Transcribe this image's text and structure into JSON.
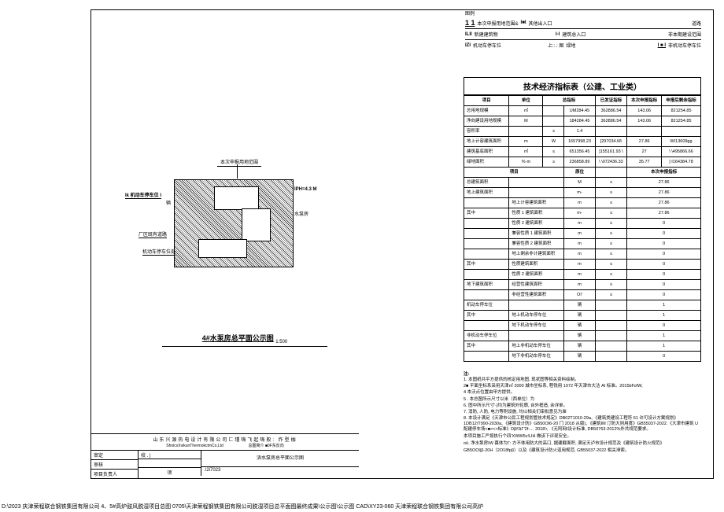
{
  "drawing": {
    "annot_top": "本次申报用地范围",
    "label_ik": "Ik 机动车停车位 I",
    "label_ik_sub": "辆",
    "label_iph": "IPH=4.3 M",
    "label_plant": "水泵房",
    "label_road": "厂区既有道路",
    "label_park": "机动车停车位处",
    "title": "4#水泵房总平面公示图",
    "title_scale": "1:500"
  },
  "legend": {
    "header": "图例",
    "r1c1_sym": "1   1",
    "r1c1_txt": "本次申报用地范围&",
    "r1c2_sym": "I■I",
    "r1c2_txt": "其他出入口",
    "r1c3_txt": "道路",
    "r2c1_sym": "ILII",
    "r2c1_txt": "新建建筑物",
    "r2c2_sym": "I-I",
    "r2c2_txt": "建筑总入口",
    "r2c3_txt": "非本期建设范围",
    "r3c1_sym": "IZI",
    "r3c1_txt": "机动车停车位",
    "r3c2_sym": "上::.: 图",
    "r3c2_txt": "绿地",
    "r3c3_sym": "I ■ I",
    "r3c3_txt": "非机动车停车位"
  },
  "eco": {
    "title": "技术经济指标表（公建、工业类）",
    "head": [
      "项目",
      "单位",
      "总指标",
      "已发证指标",
      "本次申报指标",
      "申报后剩余指标"
    ],
    "rows1": [
      {
        "name": "总用地规模",
        "unit": "㎡",
        "note": "",
        "v1": "UM284.45",
        "v2": "362886.54",
        "v3": "143.06",
        "v4": "821254.85"
      },
      {
        "name": "净向建设用地规模",
        "unit": "M",
        "note": "",
        "v1": "184284.45",
        "v2": "362886.54",
        "v3": "143.06",
        "v4": "821254.85"
      },
      {
        "name": "容积率",
        "unit": "",
        "note": "≤",
        "v1": "1.4",
        "v2": "",
        "v3": "",
        "v4": ""
      },
      {
        "name": "地上计容建筑面积",
        "unit": "m",
        "note": "W",
        "v1": "1657998.23",
        "v2": "[297034.M\\",
        "v3": "27.86",
        "v4": "WI13609gg"
      },
      {
        "name": "建筑基底面积",
        "unit": "㎡",
        "note": "≤",
        "v1": "651356.45",
        "v2": "]155161.93        \\",
        "v3": "27",
        "v4": "\\ \\495866.66"
      },
      {
        "name": "绿地面积",
        "unit": "%·m",
        "note": "≥",
        "v1": "236858.89",
        "v2": "\\ \\072436.33",
        "v3": "35.77",
        "v4": "] I164384.78"
      }
    ],
    "sub_head": [
      "项目",
      "",
      "原位",
      "",
      "本次申报指标",
      ""
    ],
    "rows2": [
      {
        "c0": "总建筑面积",
        "c1": "",
        "c2": "M",
        "c3": "≤",
        "c4": "27.86",
        "c5": ""
      },
      {
        "c0": "地上建筑面积",
        "c1": "",
        "c2": "m-",
        "c3": "≤",
        "c4": "27.86",
        "c5": ""
      },
      {
        "c0": "",
        "c1": "地上计容建筑面积",
        "c2": "m",
        "c3": "≤",
        "c4": "27.86",
        "c5": ""
      },
      {
        "c0": "其中",
        "c1": "性质 1 建筑面积",
        "c2": "m-",
        "c3": "≤",
        "c4": "27.86",
        "c5": ""
      },
      {
        "c0": "",
        "c1": "性质 2 建筑面积",
        "c2": "m",
        "c3": "≤",
        "c4": "0",
        "c5": ""
      },
      {
        "c0": "",
        "c1": "兼容性质 1 建筑面积",
        "c2": "m",
        "c3": "≤",
        "c4": "0",
        "c5": ""
      },
      {
        "c0": "",
        "c1": "兼容性质 2 建筑面积",
        "c2": "m",
        "c3": "≤",
        "c4": "0",
        "c5": ""
      },
      {
        "c0": "",
        "c1": "地上剩余非计建筑面积",
        "c2": "m",
        "c3": "≤",
        "c4": "0",
        "c5": ""
      },
      {
        "c0": "其中",
        "c1": "性质建筑面积",
        "c2": "m",
        "c3": "≤",
        "c4": "0",
        "c5": ""
      },
      {
        "c0": "",
        "c1": "性质 2 建筑面积",
        "c2": "m",
        "c3": "≤",
        "c4": "0",
        "c5": ""
      },
      {
        "c0": "地下建筑面积",
        "c1": "经营性建筑面积",
        "c2": "m",
        "c3": "≤",
        "c4": "0",
        "c5": ""
      },
      {
        "c0": "",
        "c1": "非经营性建筑面积",
        "c2": "OI'",
        "c3": "≤",
        "c4": "0",
        "c5": ""
      },
      {
        "c0": "机动车停车位",
        "c1": "",
        "c2": "辆",
        "c3": "",
        "c4": "1",
        "c5": ""
      },
      {
        "c0": "其中",
        "c1": "地上机动车停车位",
        "c2": "辆",
        "c3": "",
        "c4": "1",
        "c5": ""
      },
      {
        "c0": "",
        "c1": "地下机动车停车位",
        "c2": "辆",
        "c3": "",
        "c4": "0",
        "c5": ""
      },
      {
        "c0": "非机动车停车位",
        "c1": "",
        "c2": "辆",
        "c3": "",
        "c4": "1",
        "c5": ""
      },
      {
        "c0": "其中",
        "c1": "地上非机动车停车位",
        "c2": "辆",
        "c3": "",
        "c4": "1",
        "c5": ""
      },
      {
        "c0": "",
        "c1": "地下非机动车停车位",
        "c2": "辆",
        "c3": "",
        "c4": "0",
        "c5": ""
      }
    ]
  },
  "notes": {
    "header": "注:",
    "items": [
      "1. 本图纸共平方提供的核定用地图, 现状图等相关资料绘制。",
      "2■ 平面坐标系采用天津㎡ 2000 城市坐标系,\n    程铣用 1972 年天津市大沽 AI 标准。2015bf!ofW,",
      "4            本沃点位置由甲方提供。",
      "5       .   本总图所示尺寸以米（西单位）为",
      "6. 图中所示尺寸'-]均为建筑外轮廓, 台外框造, 余详单。",
      "7.            消防, 人防, 电力等附设施, 均以相关们审批意见为准",
      "8. 本设计满足《天津市公民工程规划管技术规定》DB02T1010-29a、《建筑类建设工程符 61 许可设计方案规划》1DB12/T990-2030a、《建筑设计防》GB50OI6-20 门 2018 从版)、《建筑IM 汀防大则用度》GB55037-2022.《大津市建筑 U 配建停车场<■><>标准》Dβf'ΔΓ'2f-… 2018'r, 《无阿网I设计标准, DB50763-2012%外共规范要求。",
      "",
      "本项目施工严按执行个四'XWW5v!LIH 做该下评现安全。",
      "oǔ.  净水泵房IW 幕体为Γ: 方不体用防大的高口, 据建截面积, 满足天泸市设计规范及《建筑设计防火规范》",
      "",
      "GB5OOl|β-20H（2O18fpβ）以及《建筑设计防火道用规范, GB55037-2022 相关滞索。"
    ]
  },
  "titleBlock": {
    "company_cn": "山东兴源热电设计有限公司匚瑾嗨飞起嗨般: 炸型枷",
    "company_en": "ShnicxXvikunThermokctmCo,Ltd",
    "sub": "总图简介 ■0F东反向",
    "row_labels": [
      "审定",
      "审核",
      "项目负责人"
    ],
    "col_2": "校    . |",
    "drawing_name": "㳥水泵房总平面公示图",
    "proj_no_label": "项",
    "proj_no": ".\\2i7023"
  },
  "footer": "D:\\2023 庆津荣程联合钢铁集团有限公司 4、5#高炉鼓风脱湿项目总图 0705\\天津荣程钢铁集团有限公司脱湿项目总平面图最终成果\\公示图\\公示图 CAD\\XY23-060 天津荣程联合钢铁集团有限公司高炉"
}
